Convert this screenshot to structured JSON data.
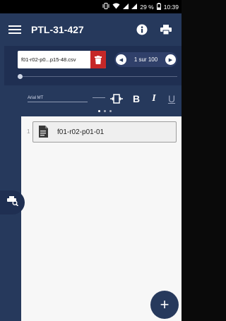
{
  "status_bar": {
    "battery_percent": "29 %",
    "time": "10:39",
    "icons": [
      "vibrate-icon",
      "wifi-icon",
      "signal-icon",
      "signal-icon",
      "battery-icon"
    ]
  },
  "app_bar": {
    "title": "PTL-31-427",
    "menu_icon": "hamburger-menu-icon",
    "info_icon": "info-icon",
    "print_icon": "print-icon"
  },
  "file_bar": {
    "file_name": "f01-r02-p0...p15-48.csv",
    "delete_icon": "trash-icon",
    "pager": {
      "prev_icon": "chevron-left-icon",
      "label": "1 sur 100",
      "next_icon": "chevron-right-icon"
    },
    "progress_fraction": 0.0
  },
  "format_bar": {
    "font_name": "Arial MT",
    "font_size": "",
    "tools": [
      {
        "name": "align-icon",
        "label": ""
      },
      {
        "name": "bold-button",
        "label": "B"
      },
      {
        "name": "italic-button",
        "label": "I"
      },
      {
        "name": "underline-button",
        "label": "U"
      }
    ],
    "page_indicator_count": 3,
    "page_indicator_active": 0
  },
  "content": {
    "rows": [
      {
        "index": "1",
        "icon": "document-icon",
        "label": "f01-r02-p01-01"
      }
    ]
  },
  "side_button": {
    "icon": "print-search-icon"
  },
  "fab": {
    "label": "+",
    "icon": "add-icon"
  },
  "colors": {
    "primary": "#26395c",
    "toolbar_dark": "#1f2f52",
    "delete_red": "#c62828",
    "content_bg": "#f7f7f7"
  }
}
